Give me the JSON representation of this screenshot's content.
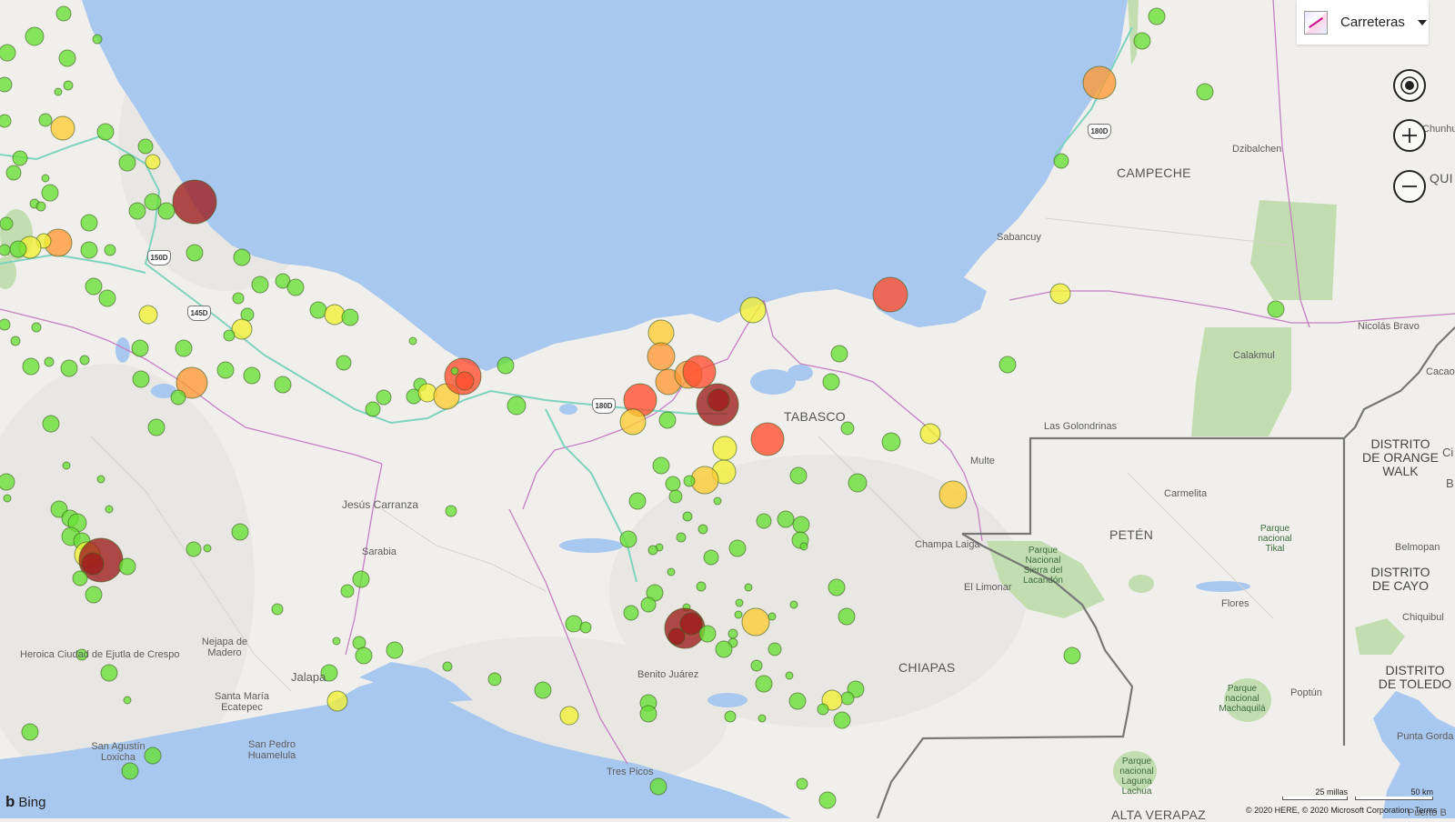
{
  "map_style": {
    "label": "Carreteras",
    "icon": "road-map-thumbnail-icon"
  },
  "controls": {
    "locate": "locate-me-icon",
    "zoom_in": "zoom-in-icon",
    "zoom_out": "zoom-out-icon"
  },
  "colors": {
    "water": "#a8c8ef",
    "land": "#f0efeb",
    "park": "#c2deb0",
    "highway": "#7ed3be",
    "state_border": "#c77fc4",
    "country_border": "#777777"
  },
  "places": {
    "campeche": "CAMPECHE",
    "tabasco": "TABASCO",
    "chiapas": "CHIAPAS",
    "peten": "PETÉN",
    "dzibalchen": "Dzibalchen",
    "sabancuy": "Sabancuy",
    "calakmul": "Calakmul",
    "nicolas_bravo": "Nicolás Bravo",
    "cacao": "Cacao",
    "chunhu": "Chunhu",
    "quir": "QUI",
    "las_golondrinas": "Las Golondrinas",
    "multe": "Multe",
    "carmelita": "Carmelita",
    "champa_laiga": "Champa Laiga",
    "el_limonar": "El Limonar",
    "flores": "Flores",
    "poptun": "Poptún",
    "belmopan": "Belmopan",
    "chiquibul": "Chiquibul",
    "punta_gorda": "Punta Gorda",
    "puerto_b": "Puerto B",
    "alta_verapaz": "ALTA VERAPAZ",
    "jesus_carranza": "Jesús Carranza",
    "sarabia": "Sarabia",
    "benito_juarez": "Benito Juárez",
    "tres_picos": "Tres Picos",
    "jalapa": "Jalapa",
    "heroica": "Heroica Ciudad de Ejutla de Crespo",
    "nejapa": "Nejapa de Madero",
    "santa_maria": "Santa María Ecatepec",
    "san_agustin": "San Agustín Loxicha",
    "san_pedro": "San Pedro Huamelula",
    "orange_walk": "DISTRITO DE ORANGE WALK",
    "cayo": "DISTRITO DE CAYO",
    "toledo": "DISTRITO DE TOLEDO",
    "ci": "Ci",
    "b": "B"
  },
  "parks": {
    "lacandon": "Parque Nacional Sierra del Lacandón",
    "tikal": "Parque nacional Tikal",
    "machaquila": "Parque nacional Machaquilá",
    "laguna_lachua": "Parque nacional Laguna Lachua"
  },
  "shields": [
    "180D",
    "150D",
    "145D",
    "180D"
  ],
  "branding": {
    "logo": "Bing"
  },
  "copyright": {
    "text": "© 2020 HERE, © 2020 Microsoft Corporation",
    "terms": "Terms"
  },
  "scale": {
    "miles": "25 millas",
    "km": "50 km"
  },
  "legend_colors": {
    "green": "#66e033",
    "yellow": "#f2f033",
    "amber": "#ffcc33",
    "orange": "#ff9933",
    "red": "#ff4d2e",
    "dark_red": "#9e1b1b"
  },
  "markers": [
    [
      70,
      15,
      8,
      "g"
    ],
    [
      38,
      40,
      10,
      "g"
    ],
    [
      107,
      43,
      5,
      "g"
    ],
    [
      8,
      58,
      9,
      "g"
    ],
    [
      74,
      64,
      9,
      "g"
    ],
    [
      5,
      93,
      8,
      "g"
    ],
    [
      75,
      94,
      5,
      "g"
    ],
    [
      64,
      101,
      4,
      "g"
    ],
    [
      50,
      132,
      7,
      "g"
    ],
    [
      69,
      141,
      13,
      "a"
    ],
    [
      5,
      133,
      7,
      "g"
    ],
    [
      116,
      145,
      9,
      "g"
    ],
    [
      22,
      174,
      8,
      "g"
    ],
    [
      15,
      190,
      8,
      "g"
    ],
    [
      140,
      179,
      9,
      "g"
    ],
    [
      160,
      161,
      8,
      "g"
    ],
    [
      168,
      178,
      8,
      "y"
    ],
    [
      50,
      196,
      4,
      "g"
    ],
    [
      55,
      212,
      9,
      "g"
    ],
    [
      38,
      224,
      5,
      "g"
    ],
    [
      45,
      227,
      5,
      "g"
    ],
    [
      7,
      246,
      7,
      "g"
    ],
    [
      214,
      222,
      24,
      "d"
    ],
    [
      151,
      232,
      9,
      "g"
    ],
    [
      168,
      222,
      9,
      "g"
    ],
    [
      183,
      232,
      9,
      "g"
    ],
    [
      98,
      245,
      9,
      "g"
    ],
    [
      121,
      275,
      6,
      "g"
    ],
    [
      98,
      275,
      9,
      "g"
    ],
    [
      64,
      267,
      15,
      "o"
    ],
    [
      48,
      265,
      8,
      "y"
    ],
    [
      33,
      272,
      12,
      "y"
    ],
    [
      20,
      274,
      9,
      "g"
    ],
    [
      5,
      275,
      6,
      "g"
    ],
    [
      214,
      278,
      9,
      "g"
    ],
    [
      266,
      283,
      9,
      "g"
    ],
    [
      286,
      313,
      9,
      "g"
    ],
    [
      311,
      309,
      8,
      "g"
    ],
    [
      325,
      316,
      9,
      "g"
    ],
    [
      262,
      328,
      6,
      "g"
    ],
    [
      103,
      315,
      9,
      "g"
    ],
    [
      118,
      328,
      9,
      "g"
    ],
    [
      163,
      346,
      10,
      "y"
    ],
    [
      272,
      346,
      7,
      "g"
    ],
    [
      266,
      362,
      11,
      "y"
    ],
    [
      252,
      369,
      6,
      "g"
    ],
    [
      350,
      341,
      9,
      "g"
    ],
    [
      368,
      346,
      11,
      "y"
    ],
    [
      385,
      349,
      9,
      "g"
    ],
    [
      5,
      357,
      6,
      "g"
    ],
    [
      40,
      360,
      5,
      "g"
    ],
    [
      17,
      375,
      5,
      "g"
    ],
    [
      54,
      398,
      5,
      "g"
    ],
    [
      93,
      396,
      5,
      "g"
    ],
    [
      34,
      403,
      9,
      "g"
    ],
    [
      76,
      405,
      9,
      "g"
    ],
    [
      154,
      383,
      9,
      "g"
    ],
    [
      202,
      383,
      9,
      "g"
    ],
    [
      155,
      417,
      9,
      "g"
    ],
    [
      211,
      421,
      17,
      "o"
    ],
    [
      248,
      407,
      9,
      "g"
    ],
    [
      196,
      437,
      8,
      "g"
    ],
    [
      277,
      413,
      9,
      "g"
    ],
    [
      311,
      423,
      9,
      "g"
    ],
    [
      378,
      399,
      8,
      "g"
    ],
    [
      454,
      375,
      4,
      "g"
    ],
    [
      422,
      437,
      8,
      "g"
    ],
    [
      410,
      450,
      8,
      "g"
    ],
    [
      455,
      436,
      8,
      "g"
    ],
    [
      462,
      423,
      7,
      "g"
    ],
    [
      470,
      432,
      10,
      "y"
    ],
    [
      491,
      436,
      14,
      "a"
    ],
    [
      509,
      414,
      20,
      "r"
    ],
    [
      511,
      419,
      10,
      "r"
    ],
    [
      556,
      402,
      9,
      "g"
    ],
    [
      568,
      446,
      10,
      "g"
    ],
    [
      56,
      466,
      9,
      "g"
    ],
    [
      172,
      470,
      9,
      "g"
    ],
    [
      73,
      512,
      4,
      "g"
    ],
    [
      111,
      527,
      4,
      "g"
    ],
    [
      7,
      530,
      9,
      "g"
    ],
    [
      65,
      560,
      9,
      "g"
    ],
    [
      77,
      570,
      9,
      "g"
    ],
    [
      85,
      575,
      10,
      "g"
    ],
    [
      78,
      590,
      10,
      "g"
    ],
    [
      90,
      595,
      9,
      "g"
    ],
    [
      96,
      610,
      14,
      "y"
    ],
    [
      111,
      616,
      24,
      "d"
    ],
    [
      102,
      620,
      12,
      "d"
    ],
    [
      88,
      636,
      8,
      "g"
    ],
    [
      103,
      654,
      9,
      "g"
    ],
    [
      140,
      623,
      9,
      "g"
    ],
    [
      120,
      560,
      4,
      "g"
    ],
    [
      264,
      585,
      9,
      "g"
    ],
    [
      213,
      604,
      8,
      "g"
    ],
    [
      228,
      603,
      4,
      "g"
    ],
    [
      397,
      637,
      9,
      "g"
    ],
    [
      382,
      650,
      7,
      "g"
    ],
    [
      305,
      670,
      6,
      "g"
    ],
    [
      496,
      562,
      6,
      "g"
    ],
    [
      90,
      720,
      6,
      "g"
    ],
    [
      120,
      740,
      9,
      "g"
    ],
    [
      140,
      770,
      4,
      "g"
    ],
    [
      33,
      805,
      9,
      "g"
    ],
    [
      168,
      831,
      9,
      "g"
    ],
    [
      143,
      848,
      9,
      "g"
    ],
    [
      395,
      707,
      7,
      "g"
    ],
    [
      400,
      721,
      9,
      "g"
    ],
    [
      370,
      705,
      4,
      "g"
    ],
    [
      434,
      715,
      9,
      "g"
    ],
    [
      362,
      740,
      9,
      "g"
    ],
    [
      371,
      771,
      11,
      "y"
    ],
    [
      492,
      733,
      5,
      "g"
    ],
    [
      544,
      747,
      7,
      "g"
    ],
    [
      597,
      759,
      9,
      "g"
    ],
    [
      626,
      787,
      10,
      "y"
    ],
    [
      724,
      865,
      9,
      "g"
    ],
    [
      727,
      366,
      14,
      "a"
    ],
    [
      727,
      392,
      15,
      "o"
    ],
    [
      735,
      420,
      14,
      "o"
    ],
    [
      757,
      412,
      15,
      "o"
    ],
    [
      769,
      409,
      18,
      "r"
    ],
    [
      704,
      440,
      18,
      "r"
    ],
    [
      789,
      445,
      23,
      "d"
    ],
    [
      790,
      440,
      12,
      "d"
    ],
    [
      696,
      464,
      14,
      "a"
    ],
    [
      734,
      462,
      9,
      "g"
    ],
    [
      797,
      493,
      13,
      "y"
    ],
    [
      844,
      483,
      18,
      "r"
    ],
    [
      796,
      519,
      13,
      "y"
    ],
    [
      775,
      528,
      15,
      "a"
    ],
    [
      727,
      512,
      9,
      "g"
    ],
    [
      740,
      532,
      8,
      "g"
    ],
    [
      743,
      546,
      7,
      "g"
    ],
    [
      758,
      529,
      6,
      "g"
    ],
    [
      701,
      551,
      9,
      "g"
    ],
    [
      789,
      551,
      4,
      "g"
    ],
    [
      756,
      568,
      5,
      "g"
    ],
    [
      725,
      602,
      4,
      "g"
    ],
    [
      691,
      593,
      9,
      "g"
    ],
    [
      749,
      591,
      5,
      "g"
    ],
    [
      773,
      582,
      5,
      "g"
    ],
    [
      811,
      603,
      9,
      "g"
    ],
    [
      782,
      613,
      8,
      "g"
    ],
    [
      738,
      629,
      4,
      "g"
    ],
    [
      718,
      605,
      5,
      "g"
    ],
    [
      771,
      645,
      5,
      "g"
    ],
    [
      720,
      652,
      9,
      "g"
    ],
    [
      755,
      668,
      4,
      "g"
    ],
    [
      694,
      674,
      8,
      "g"
    ],
    [
      713,
      665,
      8,
      "g"
    ],
    [
      753,
      691,
      22,
      "d"
    ],
    [
      760,
      686,
      12,
      "d"
    ],
    [
      744,
      700,
      9,
      "d"
    ],
    [
      778,
      697,
      9,
      "g"
    ],
    [
      806,
      697,
      5,
      "g"
    ],
    [
      812,
      676,
      4,
      "g"
    ],
    [
      806,
      707,
      5,
      "g"
    ],
    [
      796,
      714,
      9,
      "g"
    ],
    [
      831,
      684,
      15,
      "a"
    ],
    [
      849,
      678,
      4,
      "g"
    ],
    [
      852,
      714,
      7,
      "g"
    ],
    [
      832,
      732,
      6,
      "g"
    ],
    [
      840,
      752,
      9,
      "g"
    ],
    [
      823,
      646,
      4,
      "g"
    ],
    [
      813,
      663,
      4,
      "g"
    ],
    [
      840,
      573,
      8,
      "g"
    ],
    [
      864,
      571,
      9,
      "g"
    ],
    [
      881,
      577,
      9,
      "g"
    ],
    [
      880,
      594,
      9,
      "g"
    ],
    [
      884,
      601,
      4,
      "g"
    ],
    [
      873,
      665,
      4,
      "g"
    ],
    [
      878,
      523,
      9,
      "g"
    ],
    [
      828,
      341,
      14,
      "y"
    ],
    [
      923,
      389,
      9,
      "g"
    ],
    [
      914,
      420,
      9,
      "g"
    ],
    [
      932,
      471,
      7,
      "g"
    ],
    [
      979,
      324,
      19,
      "r"
    ],
    [
      980,
      486,
      10,
      "g"
    ],
    [
      1023,
      477,
      11,
      "y"
    ],
    [
      943,
      531,
      10,
      "g"
    ],
    [
      920,
      646,
      9,
      "g"
    ],
    [
      931,
      678,
      9,
      "g"
    ],
    [
      941,
      758,
      9,
      "g"
    ],
    [
      932,
      768,
      7,
      "g"
    ],
    [
      915,
      770,
      11,
      "y"
    ],
    [
      905,
      780,
      6,
      "g"
    ],
    [
      926,
      792,
      9,
      "g"
    ],
    [
      877,
      771,
      9,
      "g"
    ],
    [
      868,
      743,
      4,
      "g"
    ],
    [
      803,
      788,
      6,
      "g"
    ],
    [
      713,
      773,
      9,
      "g"
    ],
    [
      713,
      785,
      9,
      "g"
    ],
    [
      838,
      790,
      4,
      "g"
    ],
    [
      882,
      862,
      6,
      "g"
    ],
    [
      910,
      880,
      9,
      "g"
    ],
    [
      1048,
      544,
      15,
      "a"
    ],
    [
      1108,
      401,
      9,
      "g"
    ],
    [
      1166,
      323,
      11,
      "y"
    ],
    [
      1209,
      91,
      18,
      "o"
    ],
    [
      1256,
      45,
      9,
      "g"
    ],
    [
      1272,
      18,
      9,
      "g"
    ],
    [
      1325,
      101,
      9,
      "g"
    ],
    [
      1167,
      177,
      8,
      "g"
    ],
    [
      1403,
      340,
      9,
      "g"
    ],
    [
      1179,
      721,
      9,
      "g"
    ],
    [
      631,
      686,
      9,
      "g"
    ],
    [
      644,
      690,
      6,
      "g"
    ],
    [
      500,
      408,
      4,
      "g"
    ],
    [
      8,
      548,
      4,
      "g"
    ]
  ]
}
